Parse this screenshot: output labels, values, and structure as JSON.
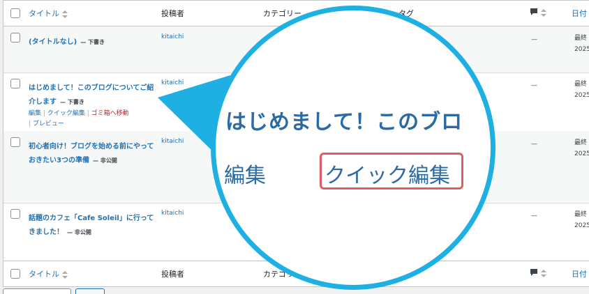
{
  "table": {
    "columns": {
      "title": "タイトル",
      "author": "投稿者",
      "categories": "カテゴリー",
      "tags": "タグ",
      "date": "日付"
    },
    "rows": [
      {
        "title": "(タイトルなし)",
        "state": "— 下書き",
        "author": "kitaichi",
        "comments": "—",
        "date": "最終",
        "year": "2025"
      },
      {
        "title": "はじめまして！このブログについてご紹介します",
        "state": "— 下書き",
        "author": "kitaichi",
        "comments": "—",
        "date": "最終",
        "year": "2025"
      },
      {
        "title": "初心者向け！ブログを始める前にやっておきたい3つの準備",
        "state": "— 非公開",
        "author": "kitaichi",
        "comments": "—",
        "date": "最終",
        "year": "2025"
      },
      {
        "title": "話題のカフェ「Cafe Soleil」に行ってきました！",
        "state": "— 非公開",
        "author": "kitaichi",
        "comments": "—",
        "date": "最終",
        "year": "2025"
      }
    ],
    "row_actions": {
      "edit": "編集",
      "quick_edit": "クイック編集",
      "trash": "ゴミ箱へ移動",
      "preview": "プレビュー",
      "sep": "|"
    }
  },
  "zoom": {
    "title": "はじめまして！このブロ",
    "edit": "編集",
    "quick_edit": "クイック編集"
  },
  "colors": {
    "link": "#2271b1",
    "trash": "#b32d2e",
    "magnifier_ring": "#1fb0e3",
    "highlight_box": "#e35c64"
  },
  "icons": [
    "sort-arrows-icon",
    "comment-bubble-icon",
    "checkbox"
  ]
}
